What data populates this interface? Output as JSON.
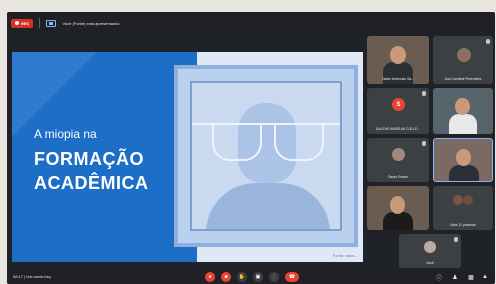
{
  "topbar": {
    "rec_label": "REC",
    "presenting_text": "Você (Fonte) está apresentando"
  },
  "slide": {
    "title_line1": "A miopia na",
    "title_line2": "FORMAÇÃO",
    "title_line3": "ACADÊMICA",
    "caption": "Fonte: www..."
  },
  "participants": [
    {
      "name": "Tadeu Ambrosio Sa...",
      "type": "video"
    },
    {
      "name": "Ana Carolina Pimenteira",
      "type": "avatar"
    },
    {
      "name": "SALEHE ANSELMI COLLE...",
      "type": "initial",
      "initial": "S",
      "color": "#ea4335"
    },
    {
      "name": "",
      "type": "video"
    },
    {
      "name": "Sarah Rosen",
      "type": "avatar"
    },
    {
      "name": "",
      "type": "video"
    },
    {
      "name": "",
      "type": "video"
    },
    {
      "name": "Mais 12 pessoas",
      "type": "group"
    },
    {
      "name": "Você",
      "type": "avatar"
    }
  ],
  "bottombar": {
    "time_text": "08:17 | hdr-nwdn-hsq",
    "controls": [
      "mic-off",
      "camera-off",
      "raise-hand",
      "present",
      "more",
      "end-call"
    ]
  },
  "colors": {
    "slide_blue": "#1c6ec7",
    "record_red": "#d93025",
    "end_call_red": "#ea4335"
  }
}
